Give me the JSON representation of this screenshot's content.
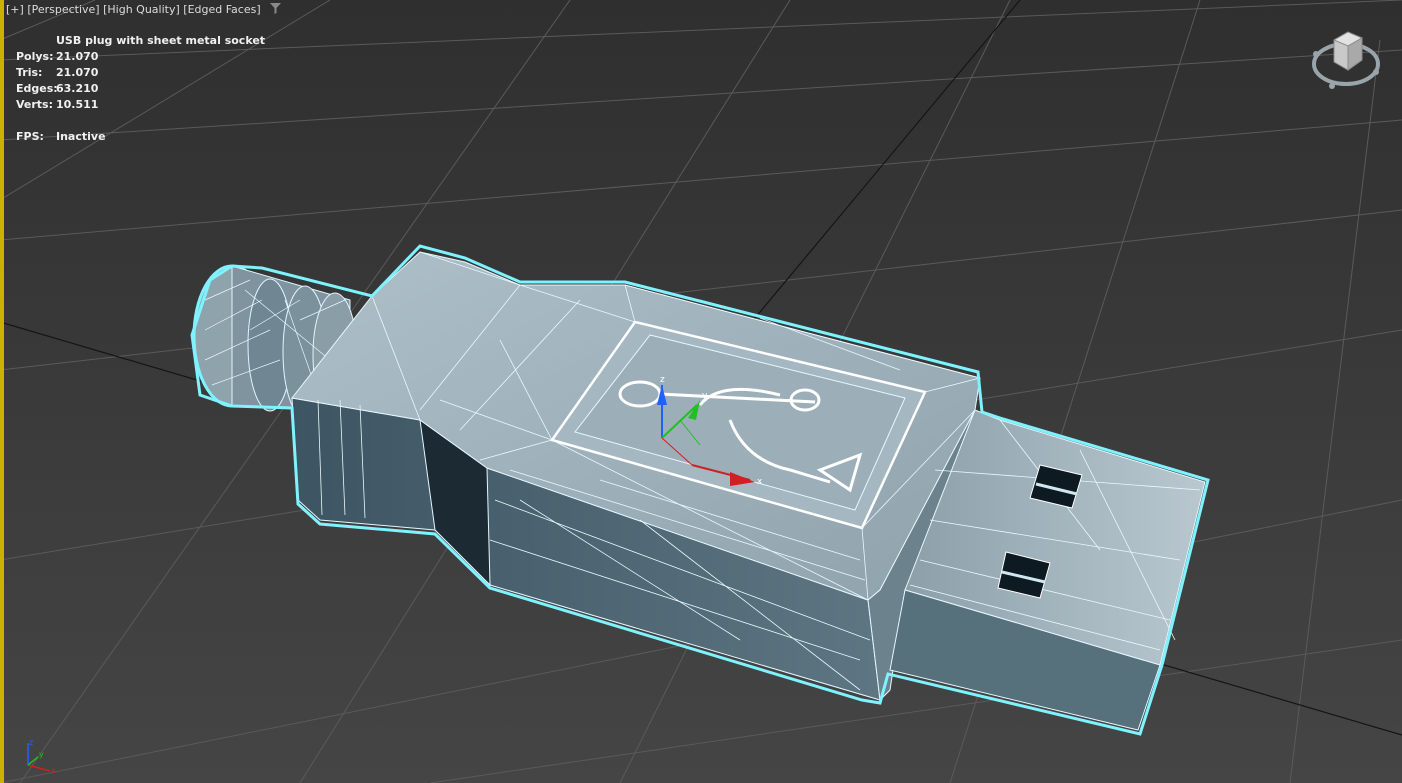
{
  "viewport": {
    "label_plus": "[+]",
    "label_view": "[Perspective]",
    "label_quality": "[High Quality]",
    "label_shading": "[Edged Faces]"
  },
  "stats": {
    "object_name": "USB plug with sheet metal socket",
    "polys_label": "Polys:",
    "polys_value": "21.070",
    "tris_label": "Tris:",
    "tris_value": "21.070",
    "edges_label": "Edges:",
    "edges_value": "63.210",
    "verts_label": "Verts:",
    "verts_value": "10.511",
    "fps_label": "FPS:",
    "fps_value": "Inactive"
  },
  "gizmo": {
    "x_label": "x",
    "y_label": "y",
    "z_label": "z"
  },
  "colors": {
    "viewport_bg": "#3a3a3a",
    "grid": "#555555",
    "grid_major": "#111111",
    "selection_outline": "#7ef3ff",
    "viewport_active_border": "#c8b400",
    "x_axis": "#d02020",
    "y_axis": "#20c020",
    "z_axis": "#2060ff"
  },
  "icons": {
    "filter": "funnel-icon",
    "viewcube": "viewcube-icon",
    "axis_tripod": "axis-tripod-icon"
  }
}
